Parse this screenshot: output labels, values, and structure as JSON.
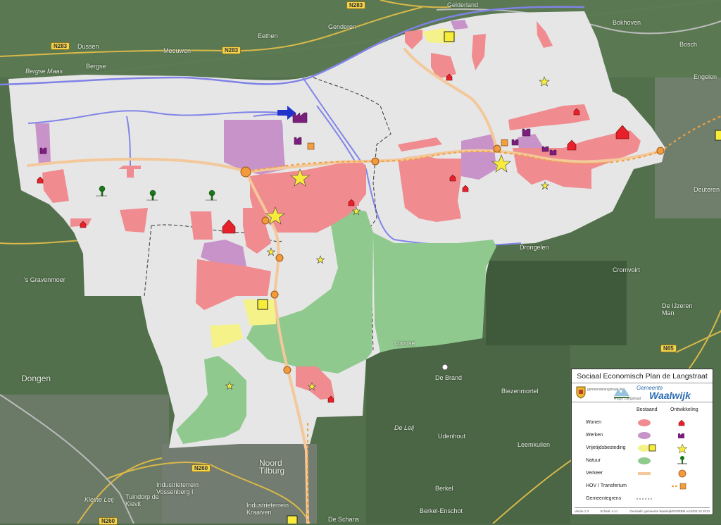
{
  "map": {
    "place_labels": {
      "gelderland": "Gelderland",
      "bokhoven": "Bokhoven",
      "genderen": "Genderen",
      "eethen": "Eethen",
      "dussen": "Dussen",
      "meeuwen": "Meeuwen",
      "bergse": "Bergse",
      "bergse_maas": "Bergse Maas",
      "bosch": "Bosch",
      "engelen": "Engelen",
      "deuteren": "Deuteren",
      "drongelen": "Drongelen",
      "cromvoirt": "Cromvoirt",
      "gravenmoer": "'s Gravenmoer",
      "dongen": "Dongen",
      "de_ijzeren_man": "De IJzeren Man",
      "biezenmortel": "Biezenmortel",
      "udenhout": "Udenhout",
      "de_brand": "De Brand",
      "loonse": "Loonse",
      "leemkuilen": "Leemkuilen",
      "noord_tilburg": "Noord Tilburg",
      "industrieterrein_vossenberg": "Industrieterrein Vossenberg I",
      "tuindorp": "Tuindorp de Kievit",
      "industrieterrein_kraaiven": "Industrieterrein Kraaiven",
      "de_schans": "De Schans",
      "berkel": "Berkel",
      "berkel_enschot": "Berkel-Enschot",
      "kleine_leij": "Kleine Leij",
      "de_leij": "De Leij"
    },
    "road_shields": {
      "n283_top": "N283",
      "n283_left": "N283",
      "n283_mid": "N283",
      "n260": "N260",
      "n65": "N65",
      "n260_bottom": "N260"
    }
  },
  "legend": {
    "title": "Sociaal Economisch Plan de Langstraat",
    "logo_captions": {
      "municipality": "gemeentelangstraat.de",
      "regio": "Regio Langstraat"
    },
    "brand_small": "Gemeente",
    "brand_large": "Waalwijk",
    "col_existing": "Bestaand",
    "col_development": "Ontwikkeling",
    "rows": [
      {
        "label": "Wonen",
        "color": "#f08c90",
        "icon": "house-icon"
      },
      {
        "label": "Werken",
        "color": "#c893c9",
        "icon": "factory-icon"
      },
      {
        "label": "Vrijetijdsbesteding",
        "color": "#f6f28a",
        "icon": "star-icon"
      },
      {
        "label": "Natuur",
        "color": "#8fc98e",
        "icon": "tree-icon"
      },
      {
        "label": "Verkeer",
        "color": "#f3c89a",
        "icon": "circle-icon"
      },
      {
        "label": "HOV / Transferium",
        "color": "#f0a040",
        "icon": "dashed-line-icon"
      },
      {
        "label": "Gemeentegrens",
        "color": "#555555",
        "icon": "boundary-icon"
      }
    ],
    "footer": {
      "version": "Versie 1.3",
      "scale": "Schaal: n.v.t.",
      "credit": "Gemaakt: gemeente Waalwijk/RO/RBM Arch/D3 10 2013"
    }
  },
  "colors": {
    "wonen": "#f08c90",
    "werken": "#c893c9",
    "vrijetijd": "#f6f28a",
    "natuur": "#8fc98e",
    "verkeer": "#f3c89a",
    "hov": "#f0a040",
    "river": "#7f82e6",
    "study_area": "#e6e6e6"
  }
}
